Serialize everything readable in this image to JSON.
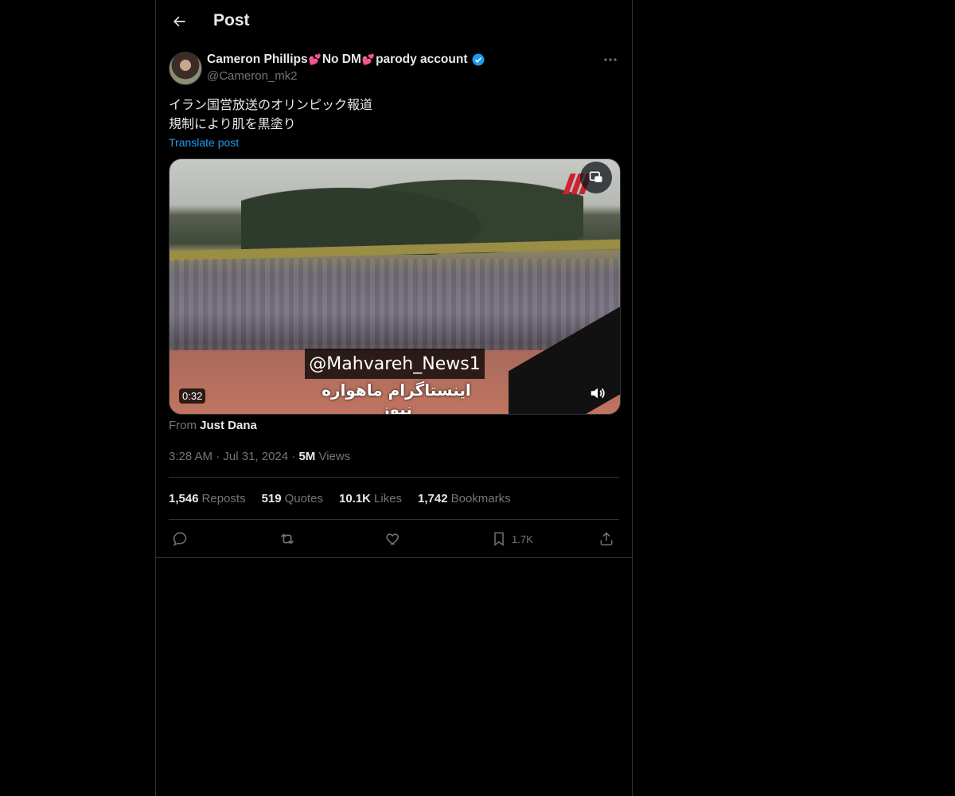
{
  "header": {
    "title": "Post"
  },
  "author": {
    "name_part1": "Cameron Phillips",
    "name_part2": "No DM",
    "name_part3": "parody account",
    "heart_glyph": "💕",
    "handle": "@Cameron_mk2"
  },
  "post": {
    "line1": "イラン国営放送のオリンピック報道",
    "line2": "規制により肌を黒塗り",
    "translate": "Translate post",
    "video": {
      "duration": "0:32",
      "watermark_handle": "@Mahvareh_News1",
      "watermark_caption": "اینستاگرام ماهواره نیوز"
    },
    "from_label": "From",
    "from_source": "Just Dana",
    "time": "3:28 AM",
    "date": "Jul 31, 2024",
    "views_count": "5M",
    "views_label": "Views"
  },
  "stats": [
    {
      "count": "1,546",
      "label": "Reposts"
    },
    {
      "count": "519",
      "label": "Quotes"
    },
    {
      "count": "10.1K",
      "label": "Likes"
    },
    {
      "count": "1,742",
      "label": "Bookmarks"
    }
  ],
  "actions": {
    "bookmark_count": "1.7K"
  },
  "colors": {
    "accent": "#1d9bf0",
    "background": "#000000",
    "muted": "#71767b",
    "border": "#2f3336"
  }
}
